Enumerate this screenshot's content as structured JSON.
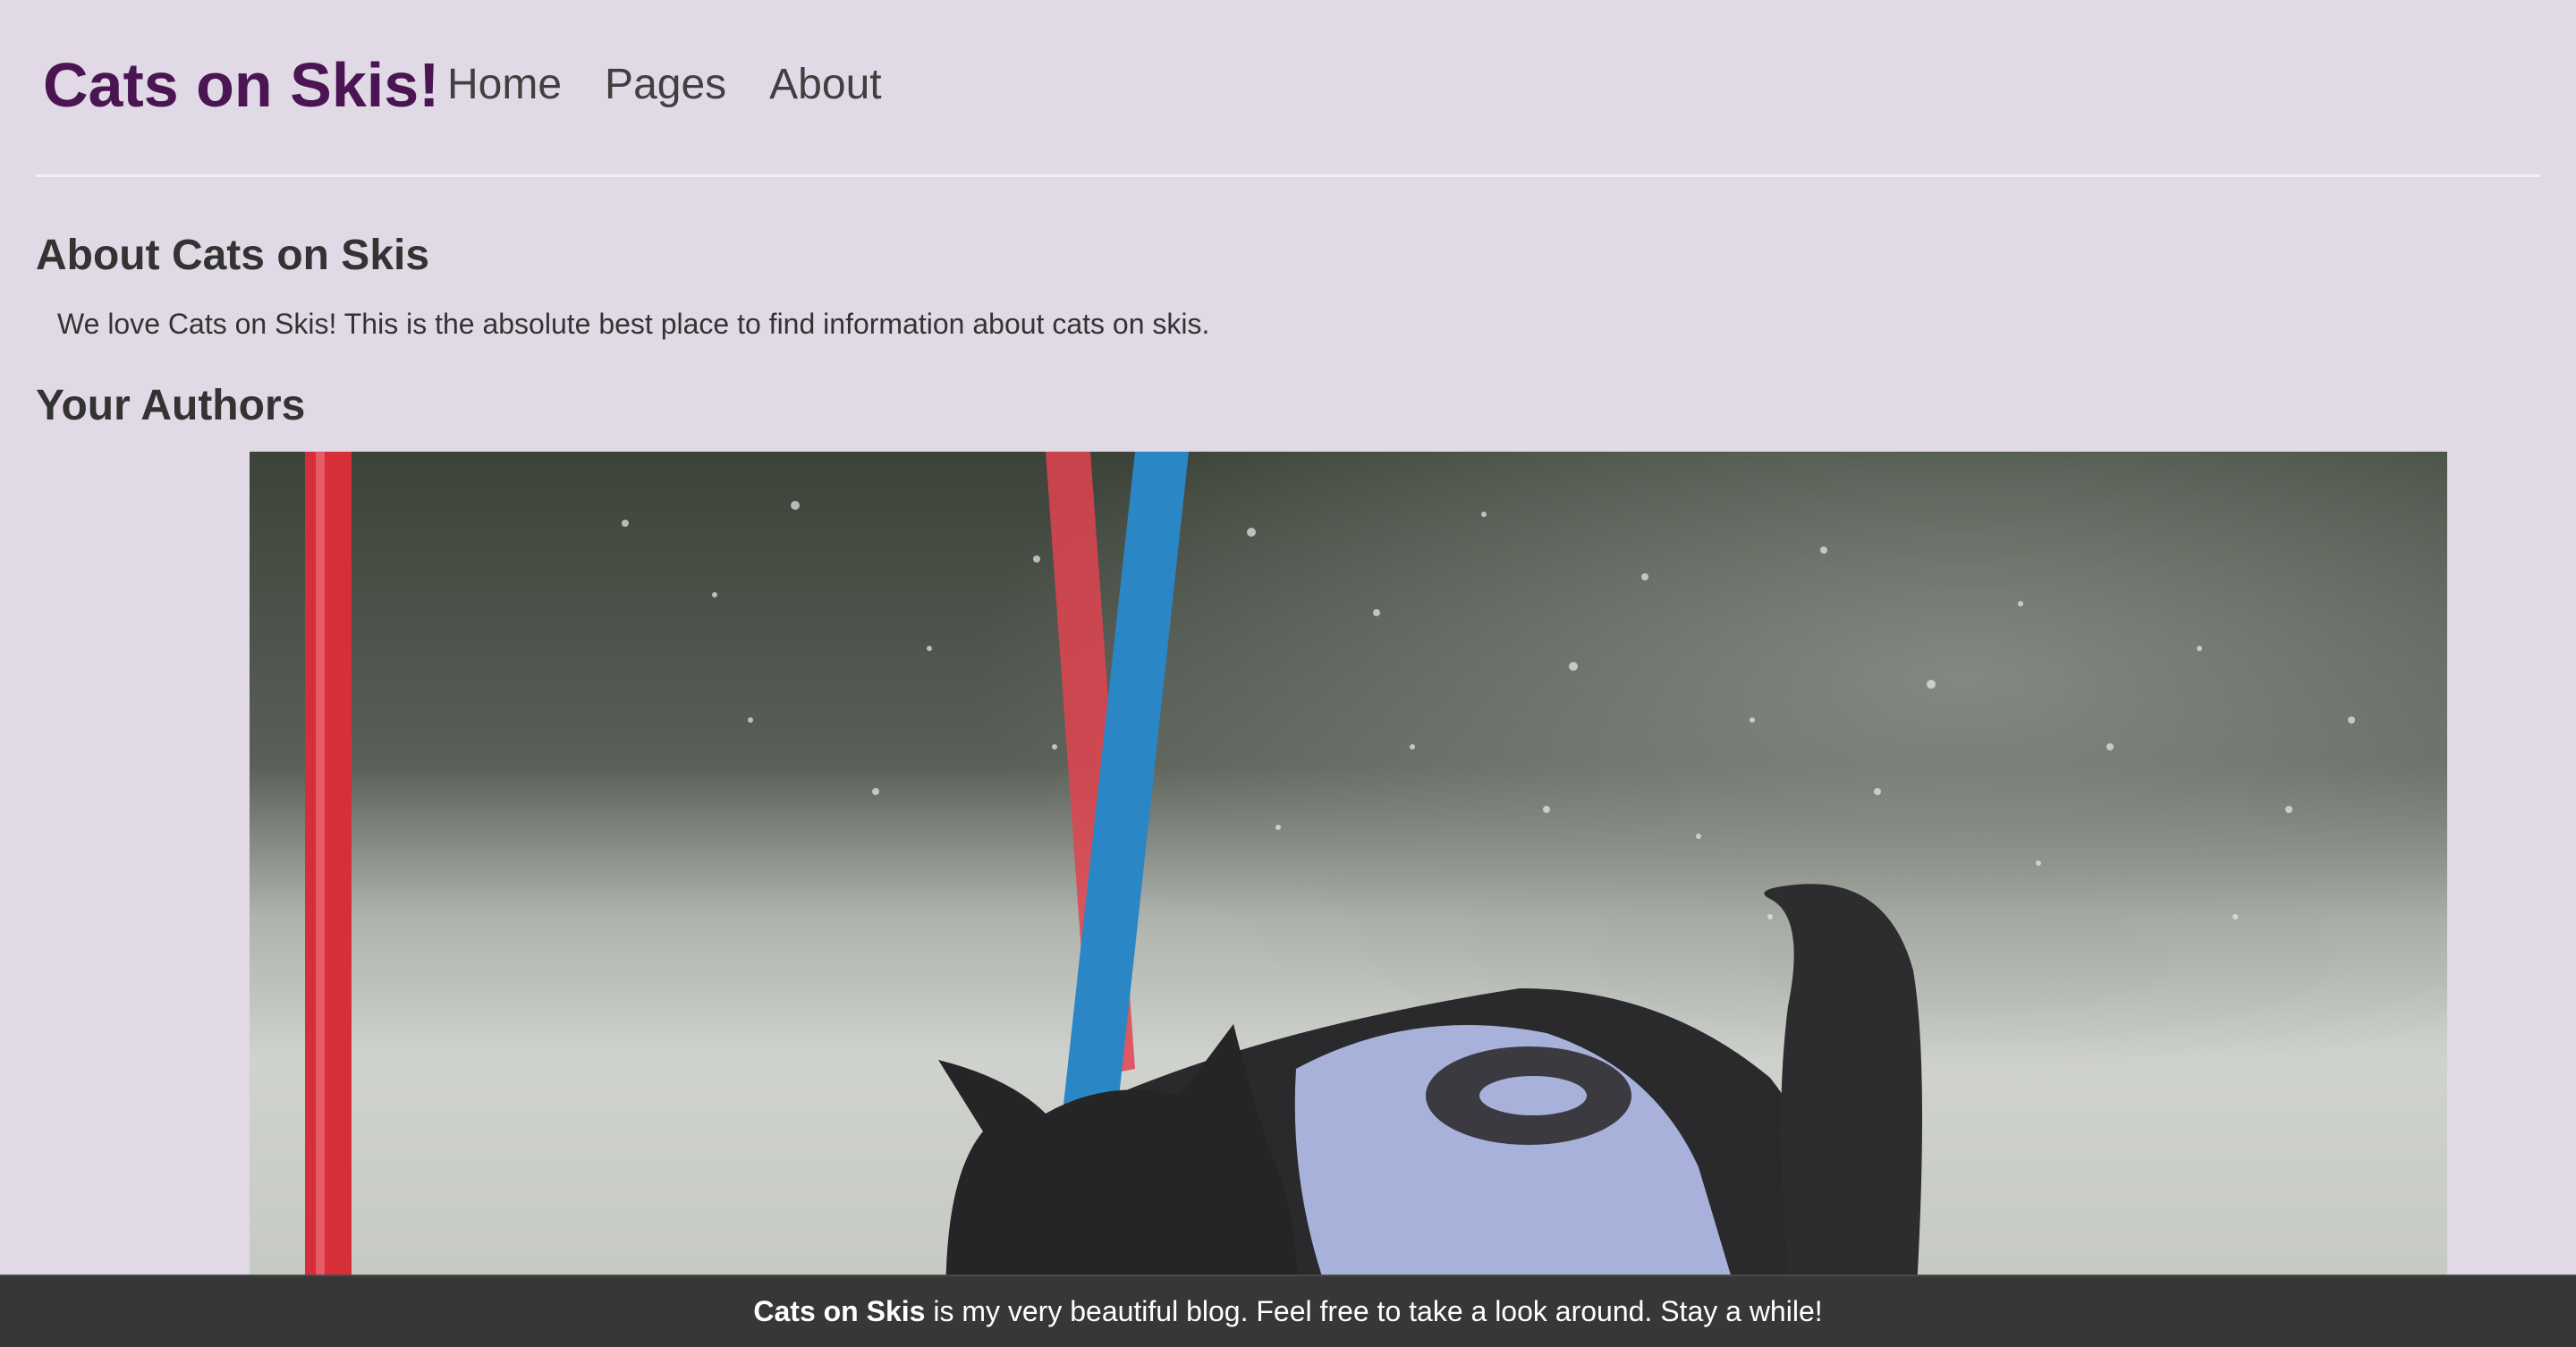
{
  "header": {
    "brand": "Cats on Skis!",
    "nav": [
      {
        "label": "Home"
      },
      {
        "label": "Pages"
      },
      {
        "label": "About"
      }
    ]
  },
  "main": {
    "about_heading": "About Cats on Skis",
    "about_text": "We love Cats on Skis! This is the absolute best place to find information about cats on skis.",
    "authors_heading": "Your Authors"
  },
  "footer": {
    "brand": "Cats on Skis",
    "text": " is my very beautiful blog. Feel free to take a look around. Stay a while!"
  },
  "colors": {
    "page_background": "#e1dae6",
    "brand": "#4a1552",
    "footer_background": "#373737"
  }
}
